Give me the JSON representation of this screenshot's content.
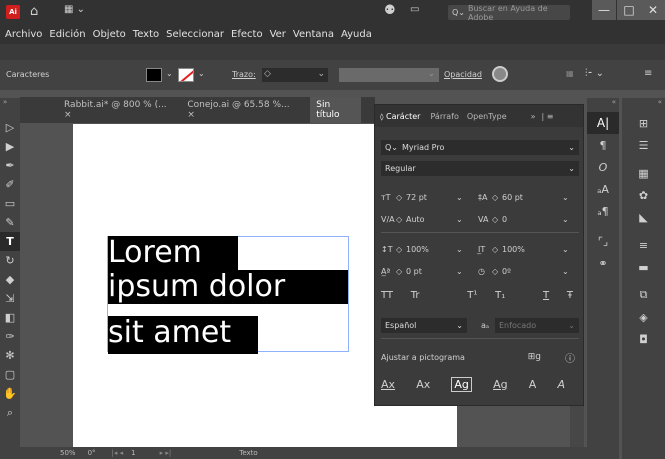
{
  "app": {
    "logo_text": "Ai",
    "search_placeholder": "Buscar en Ayuda de Adobe",
    "window_controls": [
      "—",
      "□",
      "✕"
    ]
  },
  "menu": [
    "Archivo",
    "Edición",
    "Objeto",
    "Texto",
    "Seleccionar",
    "Efecto",
    "Ver",
    "Ventana",
    "Ayuda"
  ],
  "control_bar": {
    "panel_label": "Caracteres",
    "stroke_label": "Trazo:",
    "opacity_label": "Opacidad"
  },
  "doc_tabs": [
    {
      "label": "Rabbit.ai* @ 800 % (...",
      "close": "×"
    },
    {
      "label": "Conejo.ai @ 65.58 %...",
      "close": "×"
    },
    {
      "label": "Sin título",
      "close": ""
    }
  ],
  "canvas_text": {
    "line1": "Lorem",
    "line2": "ipsum dolor",
    "line3": "sit amet"
  },
  "character_panel": {
    "tabs": [
      "Carácter",
      "Párrafo",
      "OpenType"
    ],
    "overflow": "»",
    "font_family": "Myriad Pro",
    "font_style": "Regular",
    "font_size": "72 pt",
    "leading": "60 pt",
    "kerning": "Auto",
    "tracking": "0",
    "vertical_scale": "100%",
    "horizontal_scale": "100%",
    "baseline_shift": "0 pt",
    "rotation": "0º",
    "type_buttons": [
      "TT",
      "Tr",
      "T¹",
      "T₁",
      "T",
      "Ŧ"
    ],
    "language": "Español",
    "antialias_label": "aₐ",
    "antialias": "Enfocado",
    "snap_label": "Ajustar a pictograma",
    "glyph_buttons": [
      "Ax",
      "Ax",
      "Ag",
      "Ag",
      "A",
      "A"
    ]
  },
  "status_bar": {
    "zoom": "50%",
    "rotation": "0°",
    "artboard": "1",
    "tool": "Texto"
  },
  "colors": {
    "accent_logo": "#cf1f1f",
    "selection": "#8fb2ff",
    "ui_dark": "#323232",
    "panel": "#3b3b3b"
  }
}
